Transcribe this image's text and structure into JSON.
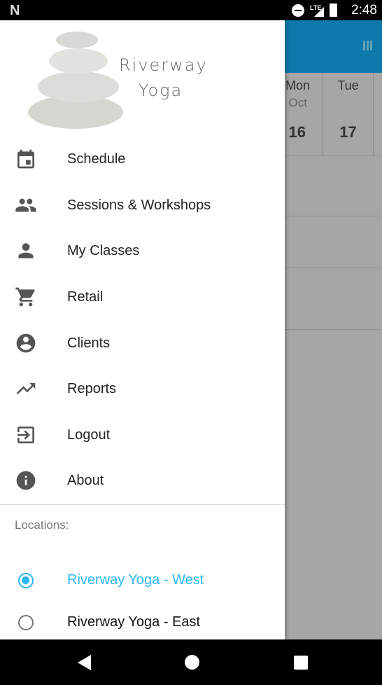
{
  "status_bar": {
    "time": "2:48",
    "network": "LTE",
    "icons": [
      "notification-n-icon",
      "do-not-disturb-icon",
      "lte-signal-icon",
      "battery-charging-icon"
    ]
  },
  "background": {
    "days": [
      {
        "name": "Mon",
        "month": "Oct",
        "date": "16"
      },
      {
        "name": "Tue",
        "month": "",
        "date": "17"
      }
    ]
  },
  "drawer": {
    "logo_text": [
      "Riverway",
      "Yoga"
    ],
    "menu": [
      {
        "label": "Schedule",
        "icon": "calendar-icon"
      },
      {
        "label": "Sessions & Workshops",
        "icon": "group-icon"
      },
      {
        "label": "My Classes",
        "icon": "person-icon"
      },
      {
        "label": "Retail",
        "icon": "cart-icon"
      },
      {
        "label": "Clients",
        "icon": "account-circle-icon"
      },
      {
        "label": "Reports",
        "icon": "trending-up-icon"
      },
      {
        "label": "Logout",
        "icon": "exit-icon"
      },
      {
        "label": "About",
        "icon": "info-icon"
      }
    ],
    "locations_label": "Locations:",
    "locations": [
      {
        "label": "Riverway Yoga - West",
        "selected": true
      },
      {
        "label": "Riverway Yoga - East",
        "selected": false
      }
    ]
  },
  "colors": {
    "accent": "#29b6f6",
    "header": "#0e7aab"
  }
}
